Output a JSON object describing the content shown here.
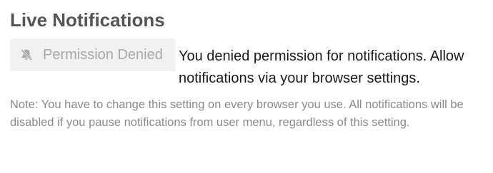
{
  "section": {
    "title": "Live Notifications"
  },
  "permission_button": {
    "label": "Permission Denied",
    "icon": "bell-slash-icon"
  },
  "status": {
    "message": "You denied permission for notifications. Allow notifications via your browser settings."
  },
  "note": {
    "text": "Note: You have to change this setting on every browser you use. All notifications will be disabled if you pause notifications from user menu, regardless of this setting."
  },
  "colors": {
    "title": "#555555",
    "button_bg": "#f1f1f1",
    "button_text": "#a8a8a8",
    "body_text": "#1a1a1a",
    "note_text": "#8a8a8a"
  }
}
